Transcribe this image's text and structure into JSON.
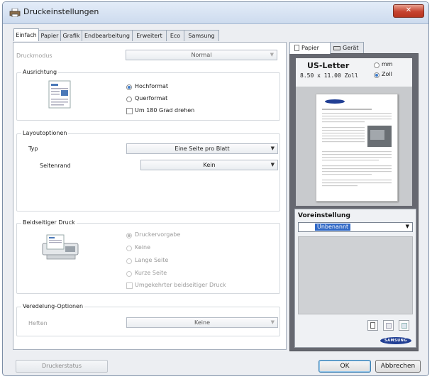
{
  "window": {
    "title": "Druckeinstellungen",
    "close_symbol": "✕"
  },
  "tabs": [
    "Einfach",
    "Papier",
    "Grafik",
    "Endbearbeitung",
    "Erweitert",
    "Eco",
    "Samsung"
  ],
  "print_mode": {
    "label": "Druckmodus",
    "value": "Normal"
  },
  "orientation": {
    "title": "Ausrichtung",
    "portrait": "Hochformat",
    "landscape": "Querformat",
    "rotate": "Um 180 Grad drehen",
    "selected": "portrait"
  },
  "layout": {
    "title": "Layoutoptionen",
    "type_label": "Typ",
    "type_value": "Eine Seite pro Blatt",
    "border_label": "Seitenrand",
    "border_value": "Kein"
  },
  "duplex": {
    "title": "Beidseitiger Druck",
    "default": "Druckervorgabe",
    "none": "Keine",
    "long": "Lange Seite",
    "short": "Kurze Seite",
    "reverse": "Umgekehrter beidseitiger Druck"
  },
  "finishing": {
    "title": "Veredelung-Optionen",
    "staple_label": "Heften",
    "staple_value": "Keine"
  },
  "buttons": {
    "status": "Druckerstatus",
    "ok": "OK",
    "cancel": "Abbrechen"
  },
  "preview": {
    "tab_paper": "Papier",
    "tab_device": "Gerät",
    "paper_name": "US-Letter",
    "paper_size": "8.50 x 11.00 Zoll",
    "unit_mm": "mm",
    "unit_inch": "Zoll",
    "selected_unit": "inch"
  },
  "preset": {
    "title": "Voreinstellung",
    "value": "Unbenannt"
  },
  "brand": {
    "logo_text": "SAMSUNG",
    "color": "#213f94"
  },
  "icons": {
    "app": "printer-icon",
    "paper_tab": "paper-icon",
    "device_tab": "printer-icon"
  }
}
